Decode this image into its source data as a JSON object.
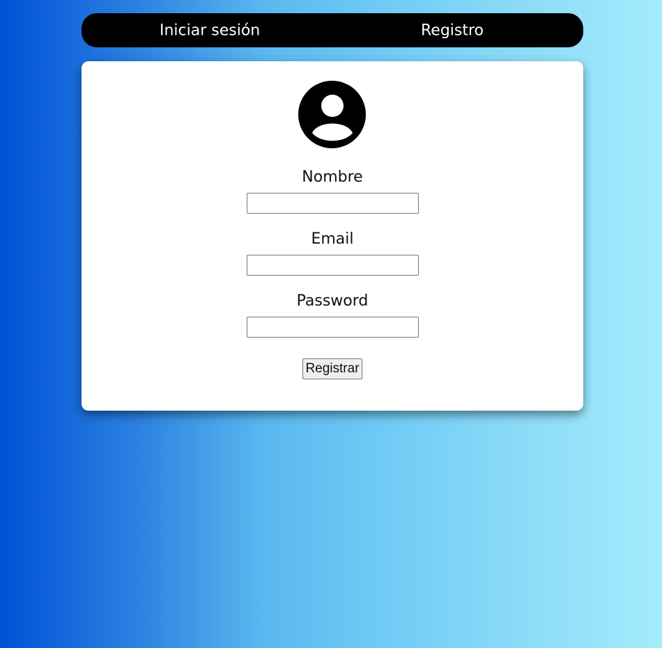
{
  "nav": {
    "login_label": "Iniciar sesión",
    "register_label": "Registro"
  },
  "form": {
    "avatar_icon": "user-circle-icon",
    "fields": [
      {
        "label": "Nombre",
        "value": "",
        "type": "text"
      },
      {
        "label": "Email",
        "value": "",
        "type": "email"
      },
      {
        "label": "Password",
        "value": "",
        "type": "password"
      }
    ],
    "submit_label": "Registrar"
  },
  "colors": {
    "gradient_start": "#0052d6",
    "gradient_end": "#a3ecfb",
    "nav_bg": "#000000",
    "card_bg": "#ffffff"
  }
}
